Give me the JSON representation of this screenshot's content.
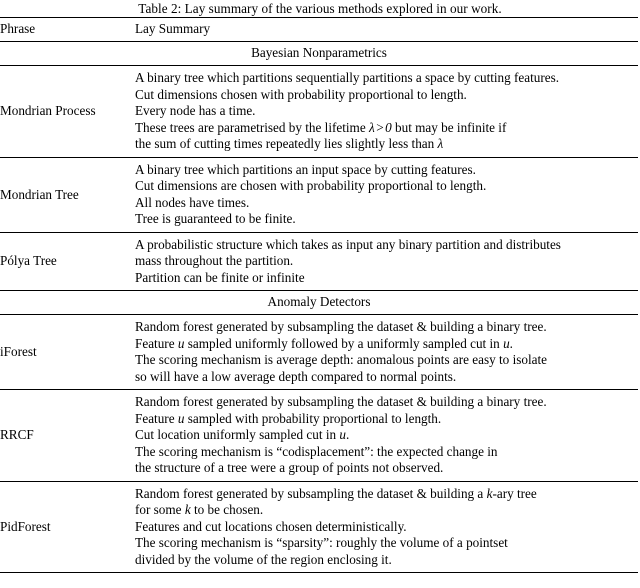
{
  "caption": "Table 2: Lay summary of the various methods explored in our work.",
  "table": {
    "columns": [
      {
        "key": "phrase",
        "header": "Phrase"
      },
      {
        "key": "summary",
        "header": "Lay Summary"
      }
    ],
    "sections": [
      {
        "title": "Bayesian Nonparametrics",
        "rows": [
          {
            "phrase": "Mondrian Process",
            "lines": [
              "A binary tree which partitions sequentially partitions a space by cutting features.",
              "Cut dimensions chosen with probability proportional to length.",
              "Every node has a time.",
              "These trees are parametrised by the lifetime λ > 0 but may be infinite if",
              "the sum of cutting times repeatedly lies slightly less than λ"
            ]
          },
          {
            "phrase": "Mondrian Tree",
            "lines": [
              "A binary tree which partitions an input space by cutting features.",
              "Cut dimensions are chosen with probability proportional to length.",
              "All nodes have times.",
              "Tree is guaranteed to be finite."
            ]
          },
          {
            "phrase": "Pólya Tree",
            "lines": [
              "A probabilistic structure which takes as input any binary partition and distributes",
              "mass throughout the partition.",
              "Partition can be finite or infinite"
            ]
          }
        ]
      },
      {
        "title": "Anomaly Detectors",
        "rows": [
          {
            "phrase": "iForest",
            "lines": [
              "Random forest generated by subsampling the dataset & building a binary tree.",
              "Feature u sampled uniformly followed by a uniformly sampled cut in u.",
              "The scoring mechanism is average depth: anomalous points are easy to isolate",
              "so will have a low average depth compared to normal points."
            ]
          },
          {
            "phrase": "RRCF",
            "lines": [
              "Random forest generated by subsampling the dataset & building a binary tree.",
              "Feature u sampled with probability proportional to length.",
              "Cut location uniformly sampled cut in u.",
              "The scoring mechanism is “codisplacement”: the expected change in",
              "the structure of a tree were a group of points not observed."
            ]
          },
          {
            "phrase": "PidForest",
            "lines": [
              "Random forest generated by subsampling the dataset & building a k-ary tree",
              "for some k to be chosen.",
              "Features and cut locations chosen deterministically.",
              "The scoring mechanism is “sparsity”: roughly the volume of a pointset",
              "divided by the volume of the region enclosing it."
            ]
          }
        ]
      }
    ]
  }
}
